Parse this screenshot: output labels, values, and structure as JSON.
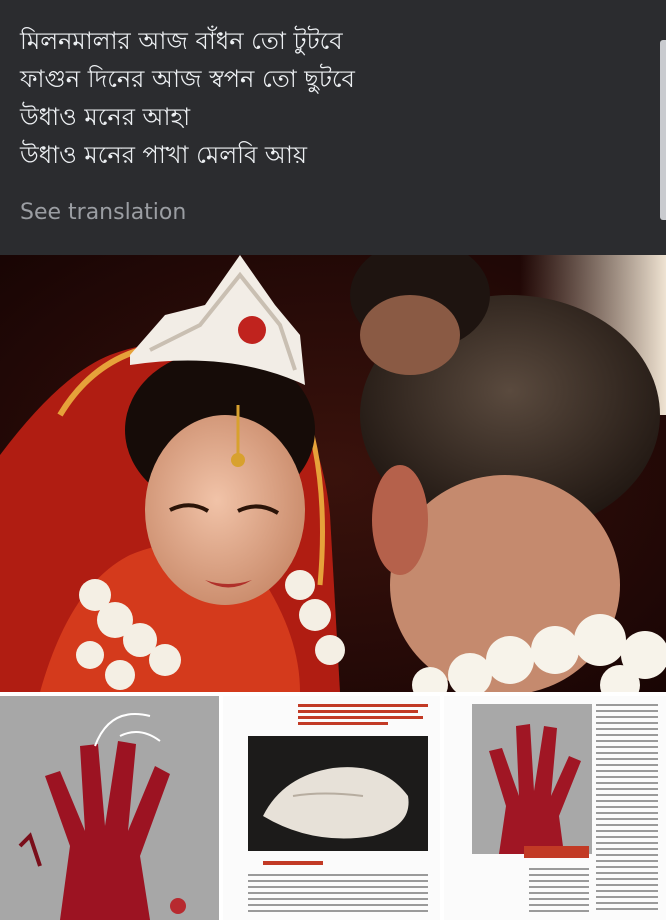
{
  "post": {
    "poem_lines": [
      "মিলনমালার আজ বাঁধন তো টুটবে",
      "ফাগুন দিনের আজ স্বপন তো ছুটবে",
      "উধাও মনের আহা",
      "উধাও মনের পাখা মেলবি আয়"
    ],
    "see_translation": "See translation"
  },
  "images": {
    "main_photo": "wedding-photo",
    "thumbnails": [
      "painted-red-hand-artwork",
      "magazine-page-sculpture",
      "magazine-page-red-hand"
    ]
  },
  "colors": {
    "background": "#2b2c2f",
    "text": "#eceff2",
    "muted_text": "#9b9ea3"
  }
}
